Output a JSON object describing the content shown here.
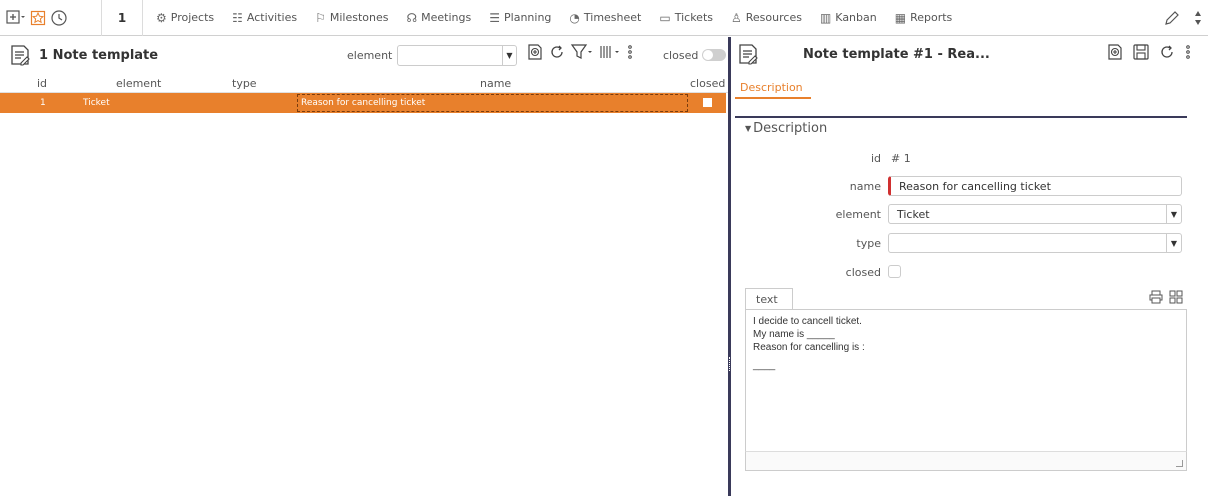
{
  "topbar": {
    "page_number": "1",
    "menu": [
      {
        "label": "Projects",
        "icon": "projects-icon",
        "glyph": "⚙"
      },
      {
        "label": "Activities",
        "icon": "activities-icon",
        "glyph": "☷"
      },
      {
        "label": "Milestones",
        "icon": "milestones-icon",
        "glyph": "⚐"
      },
      {
        "label": "Meetings",
        "icon": "meetings-icon",
        "glyph": "☊"
      },
      {
        "label": "Planning",
        "icon": "planning-icon",
        "glyph": "☰"
      },
      {
        "label": "Timesheet",
        "icon": "timesheet-icon",
        "glyph": "◔"
      },
      {
        "label": "Tickets",
        "icon": "tickets-icon",
        "glyph": "▭"
      },
      {
        "label": "Resources",
        "icon": "resources-icon",
        "glyph": "♙"
      },
      {
        "label": "Kanban",
        "icon": "kanban-icon",
        "glyph": "▥"
      },
      {
        "label": "Reports",
        "icon": "reports-icon",
        "glyph": "▦"
      }
    ]
  },
  "list": {
    "title": "1 Note template",
    "filter_label": "element",
    "filter_value": "",
    "closed_label": "closed",
    "columns": {
      "id": "id",
      "element": "element",
      "type": "type",
      "name": "name",
      "closed": "closed"
    },
    "rows": [
      {
        "id": "1",
        "element": "Ticket",
        "type": "",
        "name": "Reason for cancelling ticket",
        "closed": false
      }
    ]
  },
  "detail": {
    "title": "Note template  #1  - Rea...",
    "tab": "Description",
    "section": "Description",
    "fields": {
      "id_label": "id",
      "id_value": "#  1",
      "name_label": "name",
      "name_value": "Reason for cancelling ticket",
      "element_label": "element",
      "element_value": "Ticket",
      "type_label": "type",
      "type_value": "",
      "closed_label": "closed"
    },
    "text_tab": "text",
    "text_lines": [
      "I decide to cancell ticket.",
      "My name is _____",
      "Reason for cancelling is :",
      "",
      "____"
    ]
  },
  "colors": {
    "accent": "#e8802c",
    "splitter": "#3a3a5a",
    "required": "#d03030"
  }
}
